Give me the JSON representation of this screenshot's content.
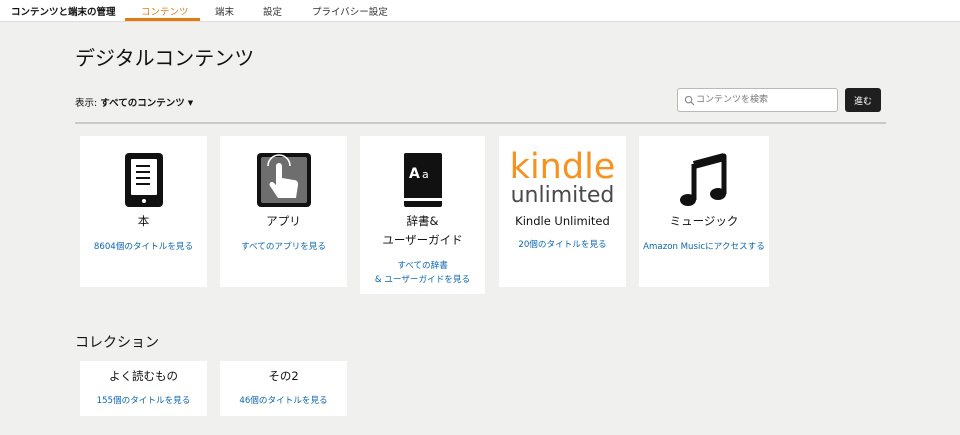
{
  "topbar": {
    "brand": "コンテンツと端末の管理",
    "tabs": [
      {
        "label": "コンテンツ",
        "active": true
      },
      {
        "label": "端末",
        "active": false
      },
      {
        "label": "設定",
        "active": false
      },
      {
        "label": "プライバシー設定",
        "active": false
      }
    ]
  },
  "page": {
    "title": "デジタルコンテンツ"
  },
  "filter": {
    "prefix": "表示:",
    "value": "すべてのコンテンツ"
  },
  "search": {
    "placeholder": "コンテンツを検索",
    "button_label": "進む"
  },
  "cards": [
    {
      "icon": "book-icon",
      "title": "本",
      "link": "8604個のタイトルを見る"
    },
    {
      "icon": "app-touch-icon",
      "title": "アプリ",
      "link": "すべてのアプリを見る"
    },
    {
      "icon": "dictionary-icon",
      "title_line1": "辞書&",
      "title_line2": "ユーザーガイド",
      "link_line1": "すべての辞書",
      "link_line2": "& ユーザーガイドを見る"
    },
    {
      "icon": "kindle-unlimited-logo",
      "logo_word1": "kindle",
      "logo_word2": "unlimited",
      "title": "Kindle Unlimited",
      "link": "20個のタイトルを見る"
    },
    {
      "icon": "music-note-icon",
      "title": "ミュージック",
      "link": "Amazon Musicにアクセスする"
    }
  ],
  "collections": {
    "heading": "コレクション",
    "items": [
      {
        "title": "よく読むもの",
        "link": "155個のタイトルを見る"
      },
      {
        "title": "その2",
        "link": "46個のタイトルを見る"
      }
    ]
  },
  "colors": {
    "accent": "#e47911",
    "link": "#0a66b3",
    "kindle_orange": "#f7921e"
  }
}
